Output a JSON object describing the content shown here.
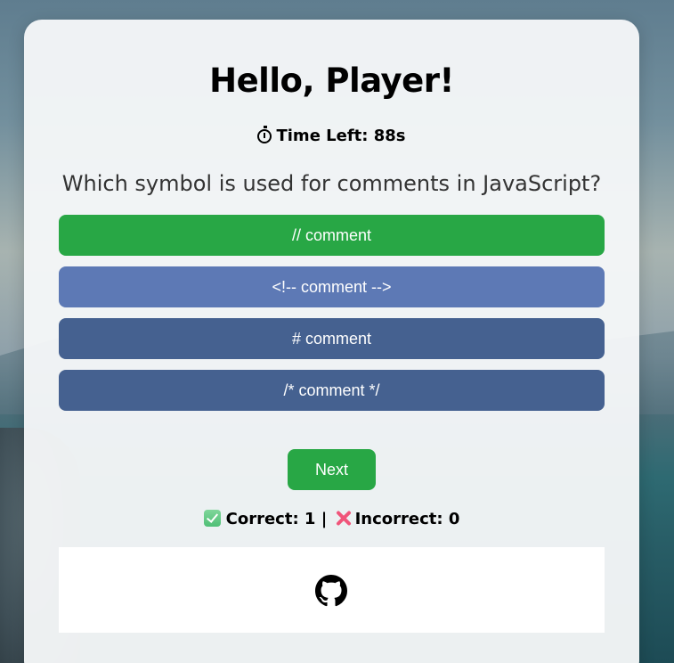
{
  "player": {
    "greeting": "Hello, Player!"
  },
  "timer": {
    "label": "Time Left: 88s",
    "icon": "stopwatch-icon"
  },
  "quiz": {
    "question": "Which symbol is used for comments in JavaScript?",
    "options": [
      {
        "label": "// comment",
        "state": "correct",
        "color": "#28a745"
      },
      {
        "label": "<!-- comment -->",
        "state": "highlighted",
        "color": "#5d79b5"
      },
      {
        "label": "# comment",
        "state": "default",
        "color": "#456190"
      },
      {
        "label": "/* comment */",
        "state": "default",
        "color": "#456190"
      }
    ],
    "next_label": "Next"
  },
  "score": {
    "correct_label": "Correct: 1",
    "separator": "|",
    "incorrect_label": "Incorrect: 0",
    "correct_icon": "check-mark-icon",
    "incorrect_icon": "cross-mark-icon"
  },
  "footer": {
    "icon": "github-icon"
  },
  "colors": {
    "accent_green": "#28a745",
    "option_blue": "#456190",
    "option_blue_hover": "#5d79b5"
  }
}
